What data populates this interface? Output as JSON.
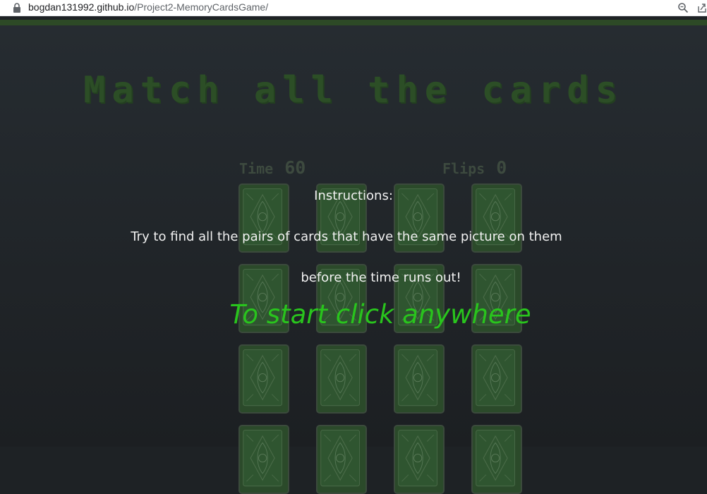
{
  "browser": {
    "url_host": "bogdan131992.github.io",
    "url_path": "/Project2-MemoryCardsGame/"
  },
  "game": {
    "title": "Match all the cards",
    "time_label": "Time",
    "time_value": "60",
    "flips_label": "Flips",
    "flips_value": "0",
    "card_count": 16
  },
  "overlay": {
    "instructions_title": "Instructions:",
    "instructions_line1": "Try to find all the pairs of cards that have the same picture on them",
    "instructions_line2": "before the time runs out!",
    "start_text": "To start click anywhere"
  },
  "colors": {
    "background": "#1e2225",
    "title": "#2c4e26",
    "start_text": "#29c41d",
    "card_back": "#2b4a2a"
  }
}
